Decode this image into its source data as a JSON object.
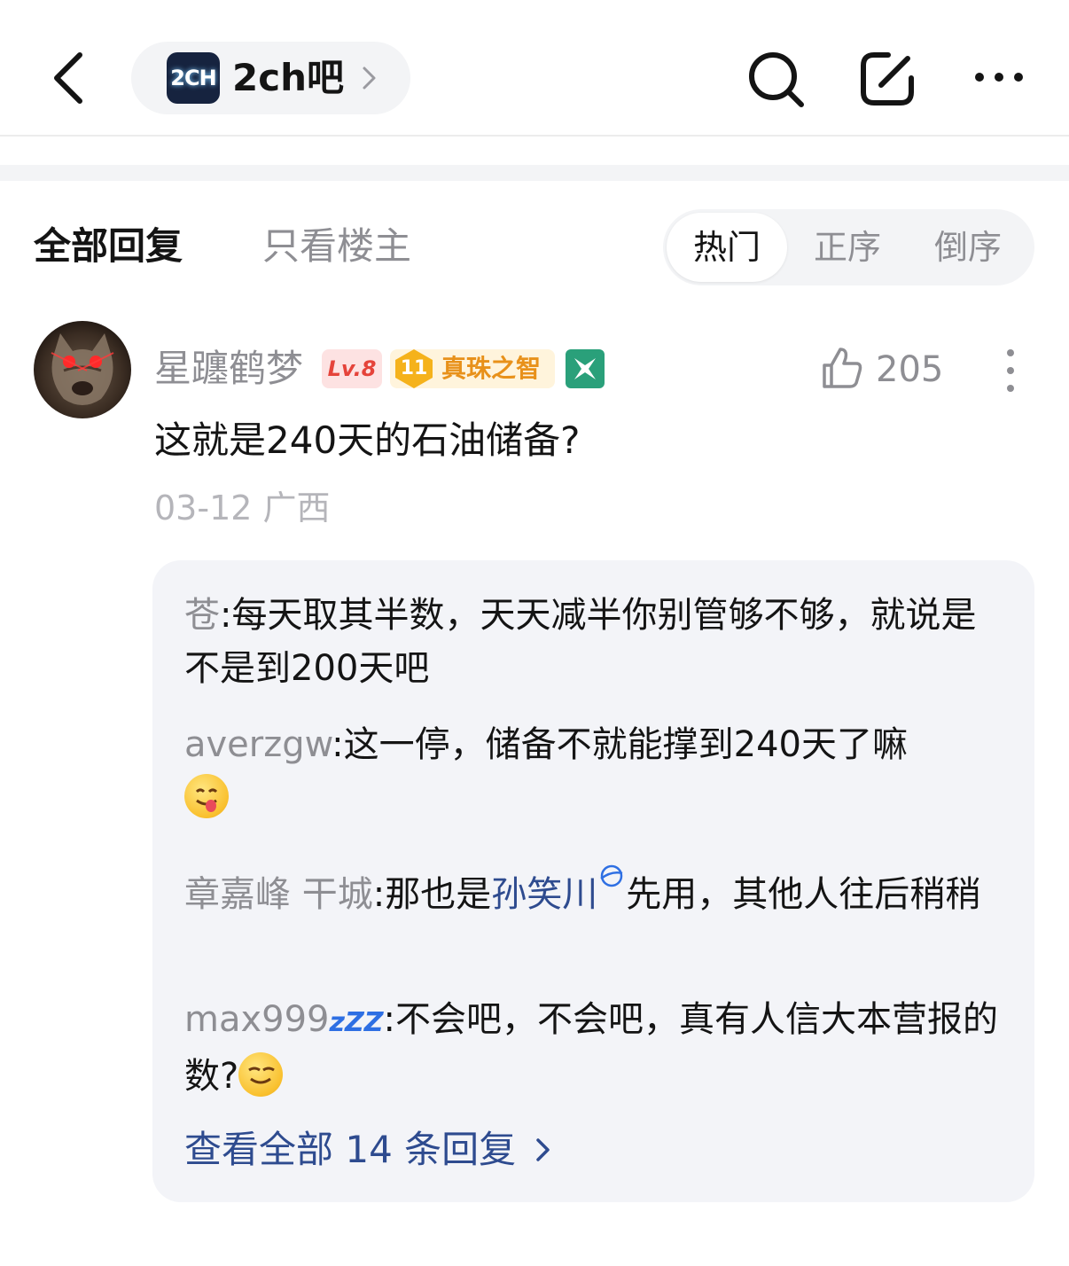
{
  "header": {
    "forum_logo_text": "2CH",
    "forum_name": "2ch吧",
    "icons": [
      "back-icon",
      "chevron-right-icon",
      "search-icon",
      "edit-icon",
      "more-icon"
    ]
  },
  "filters": {
    "all_replies": "全部回复",
    "only_op": "只看楼主",
    "sort": [
      "热门",
      "正序",
      "倒序"
    ],
    "selected_sort": "热门"
  },
  "post": {
    "username": "星躔鹤梦",
    "level": "Lv.8",
    "honor_level": "11",
    "honor_title": "真珠之智",
    "likes": "205",
    "text": "这就是240天的石油储备?",
    "date": "03-12",
    "location": "广西",
    "replies": [
      {
        "user": "苍",
        "sep": ":",
        "text": "每天取其半数，天天减半你别管够不够，就说是不是到200天吧"
      },
      {
        "user": "averzgw",
        "sep": ":",
        "text": "这一停，储备不就能撑到240天了嘛"
      },
      {
        "user": "章嘉峰 干城",
        "sep": ":",
        "pre": "那也是",
        "mention": "孙笑川",
        "text": "先用，其他人往后稍稍"
      },
      {
        "user": "max999",
        "zzz": "zZZ",
        "sep": ":",
        "text": "不会吧，不会吧，真有人信大本营报的数?"
      }
    ],
    "view_all": "查看全部 14 条回复"
  },
  "colors": {
    "link": "#2e4b8f",
    "muted": "#8e8e93",
    "lv_badge": "#e5433a",
    "honor": "#e8911a",
    "panel": "#f3f4f8"
  }
}
